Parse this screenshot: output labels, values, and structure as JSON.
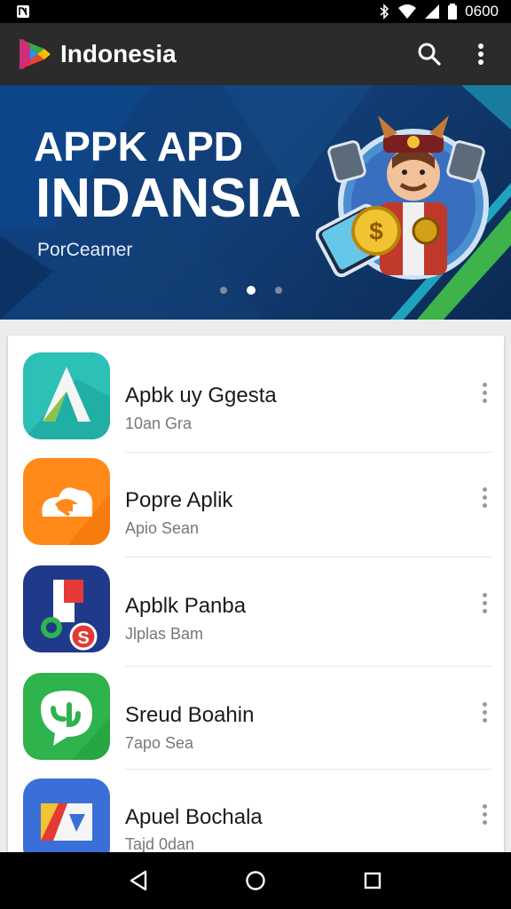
{
  "status_bar": {
    "time": "0600"
  },
  "app_bar": {
    "title": "Indonesia"
  },
  "banner": {
    "line1": "APPK APD",
    "line2": "INDANSIA",
    "subtitle": "PorCeamer",
    "active_slide": 2,
    "slide_count": 3
  },
  "apps": [
    {
      "name": "Apbk uy Ggesta",
      "subtitle": "10an Gra",
      "icon": "letter-a-icon",
      "color": "#2cc0b6"
    },
    {
      "name": "Popre Aplik",
      "subtitle": "Apio Sean",
      "icon": "cloud-arrow-icon",
      "color": "#ff8a1a"
    },
    {
      "name": "Apblk Panba",
      "subtitle": "Jlplas Bam",
      "icon": "music-note-icon",
      "color": "#1f3a8a"
    },
    {
      "name": "Sreud Boahin",
      "subtitle": "7apo Sea",
      "icon": "chat-bubble-icon",
      "color": "#2fb34c"
    },
    {
      "name": "Apuel Bochala",
      "subtitle": "Tajd 0dan",
      "icon": "play-shape-icon",
      "color": "#3a6fd8"
    }
  ],
  "colors": {
    "app_bar": "#2b2b2b",
    "banner": "#0c3f7f",
    "accent_green": "#3db34a"
  }
}
